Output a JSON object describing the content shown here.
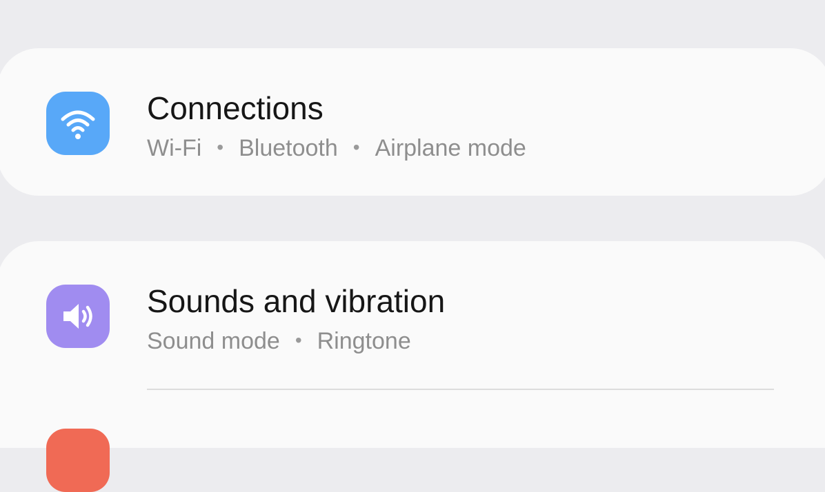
{
  "settings": {
    "connections": {
      "title": "Connections",
      "sub": [
        "Wi-Fi",
        "Bluetooth",
        "Airplane mode"
      ],
      "icon": "wifi-icon",
      "icon_color": "#58a8f8"
    },
    "sounds": {
      "title": "Sounds and vibration",
      "sub": [
        "Sound mode",
        "Ringtone"
      ],
      "icon": "speaker-icon",
      "icon_color": "#a08cf0"
    },
    "next_item": {
      "icon_color": "#f06a55"
    }
  }
}
